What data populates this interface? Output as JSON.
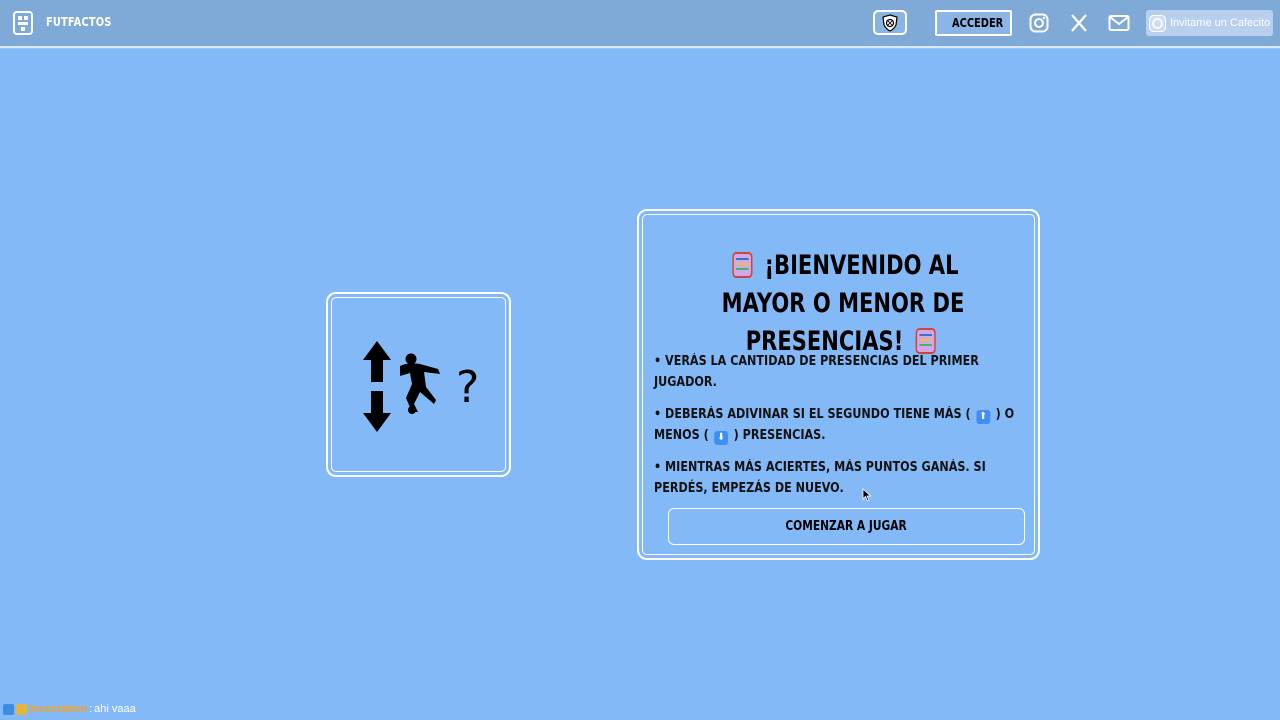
{
  "header": {
    "brand": "FUTFACTOS",
    "login_label": "ACCEDER",
    "cafecito_label": "Invitame un Cafecito",
    "icons": {
      "logo": "futfactos-logo-icon",
      "shield": "team-shield-icon",
      "user": "user-icon",
      "instagram": "instagram-icon",
      "x": "x-icon",
      "mail": "mail-icon",
      "cafecito": "cafecito-icon"
    }
  },
  "game_image": {
    "icon": "higher-lower-player-icon"
  },
  "welcome_card": {
    "title": "¡BIENVENIDO AL MAYOR O MENOR DE PRESENCIAS!",
    "title_icon": "abacus-icon",
    "line1": "• VERÁS LA CANTIDAD DE PRESENCIAS DEL PRIMER JUGADOR.",
    "line2_a": "• DEBERÁS ADIVINAR SI EL SEGUNDO TIENE MÁS (",
    "line2_up": "⬆",
    "line2_b": ") O MENOS (",
    "line2_down": "⬇",
    "line2_c": ") PRESENCIAS.",
    "line3": "• MIENTRAS MÁS ACIERTES, MÁS PUNTOS GANÁS. SI PERDÉS, EMPEZÁS DE NUEVO.",
    "play_label": "COMENZAR A JUGAR"
  },
  "chat": {
    "user": "Insectation",
    "separator": ":",
    "message": "ahi vaaa"
  },
  "colors": {
    "background": "#84b9f7",
    "header": "#7fa9d7",
    "chat_user": "#f3a21f"
  }
}
